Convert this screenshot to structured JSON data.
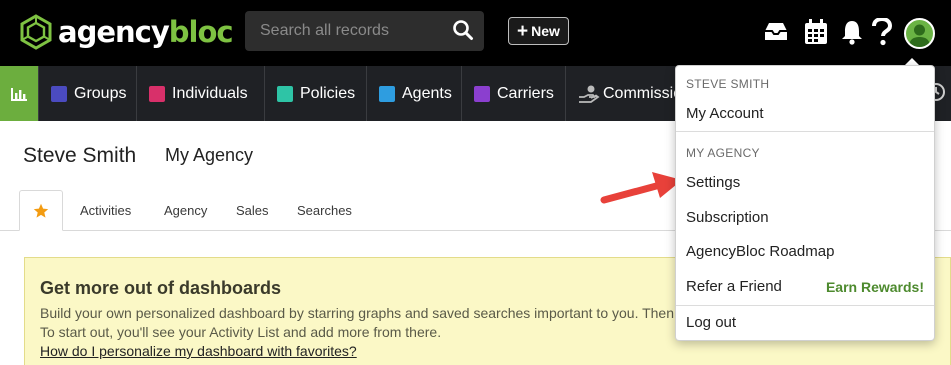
{
  "brand": {
    "logo_primary": "agency",
    "logo_secondary": "bloc",
    "logo_icon": "cube-logo-icon",
    "accent_color": "#6cae3e"
  },
  "search": {
    "placeholder": "Search all records",
    "icon": "search-icon"
  },
  "new_button": {
    "label": "New",
    "icon": "plus-icon"
  },
  "top_icons": [
    "inbox-icon",
    "calendar-icon",
    "bell-icon",
    "help-icon",
    "user-avatar-icon"
  ],
  "nav": {
    "home_icon": "bar-chart-icon",
    "items": [
      {
        "label": "Groups",
        "color": "#4b4bc0"
      },
      {
        "label": "Individuals",
        "color": "#d8306a"
      },
      {
        "label": "Policies",
        "color": "#2ec4a6"
      },
      {
        "label": "Agents",
        "color": "#2e9de0"
      },
      {
        "label": "Carriers",
        "color": "#8b3fcf"
      },
      {
        "label": "Commissio",
        "icon": "hand-coin-icon"
      }
    ]
  },
  "page": {
    "user_name": "Steve Smith",
    "agency_name": "My Agency"
  },
  "tabs": {
    "favorites_icon": "star-icon",
    "items": [
      "Activities",
      "Agency",
      "Sales",
      "Searches"
    ]
  },
  "banner": {
    "title": "Get more out of dashboards",
    "line1": "Build your own personalized dashboard by starring graphs and saved searches important to you. Then",
    "line2": "To start out, you'll see your Activity List and add more from there.",
    "link": "How do I personalize my dashboard with favorites?"
  },
  "dropdown": {
    "user_header": "STEVE SMITH",
    "my_account": "My Account",
    "agency_header": "MY AGENCY",
    "settings": "Settings",
    "subscription": "Subscription",
    "roadmap": "AgencyBloc Roadmap",
    "refer": "Refer a Friend",
    "earn_rewards": "Earn Rewards!",
    "logout": "Log out"
  },
  "colors": {
    "topbar": "#000000",
    "nav_bg": "#1f2125",
    "banner_bg": "#fbf8c6",
    "arrow": "#e8413a",
    "rewards": "#4d8a2e"
  }
}
